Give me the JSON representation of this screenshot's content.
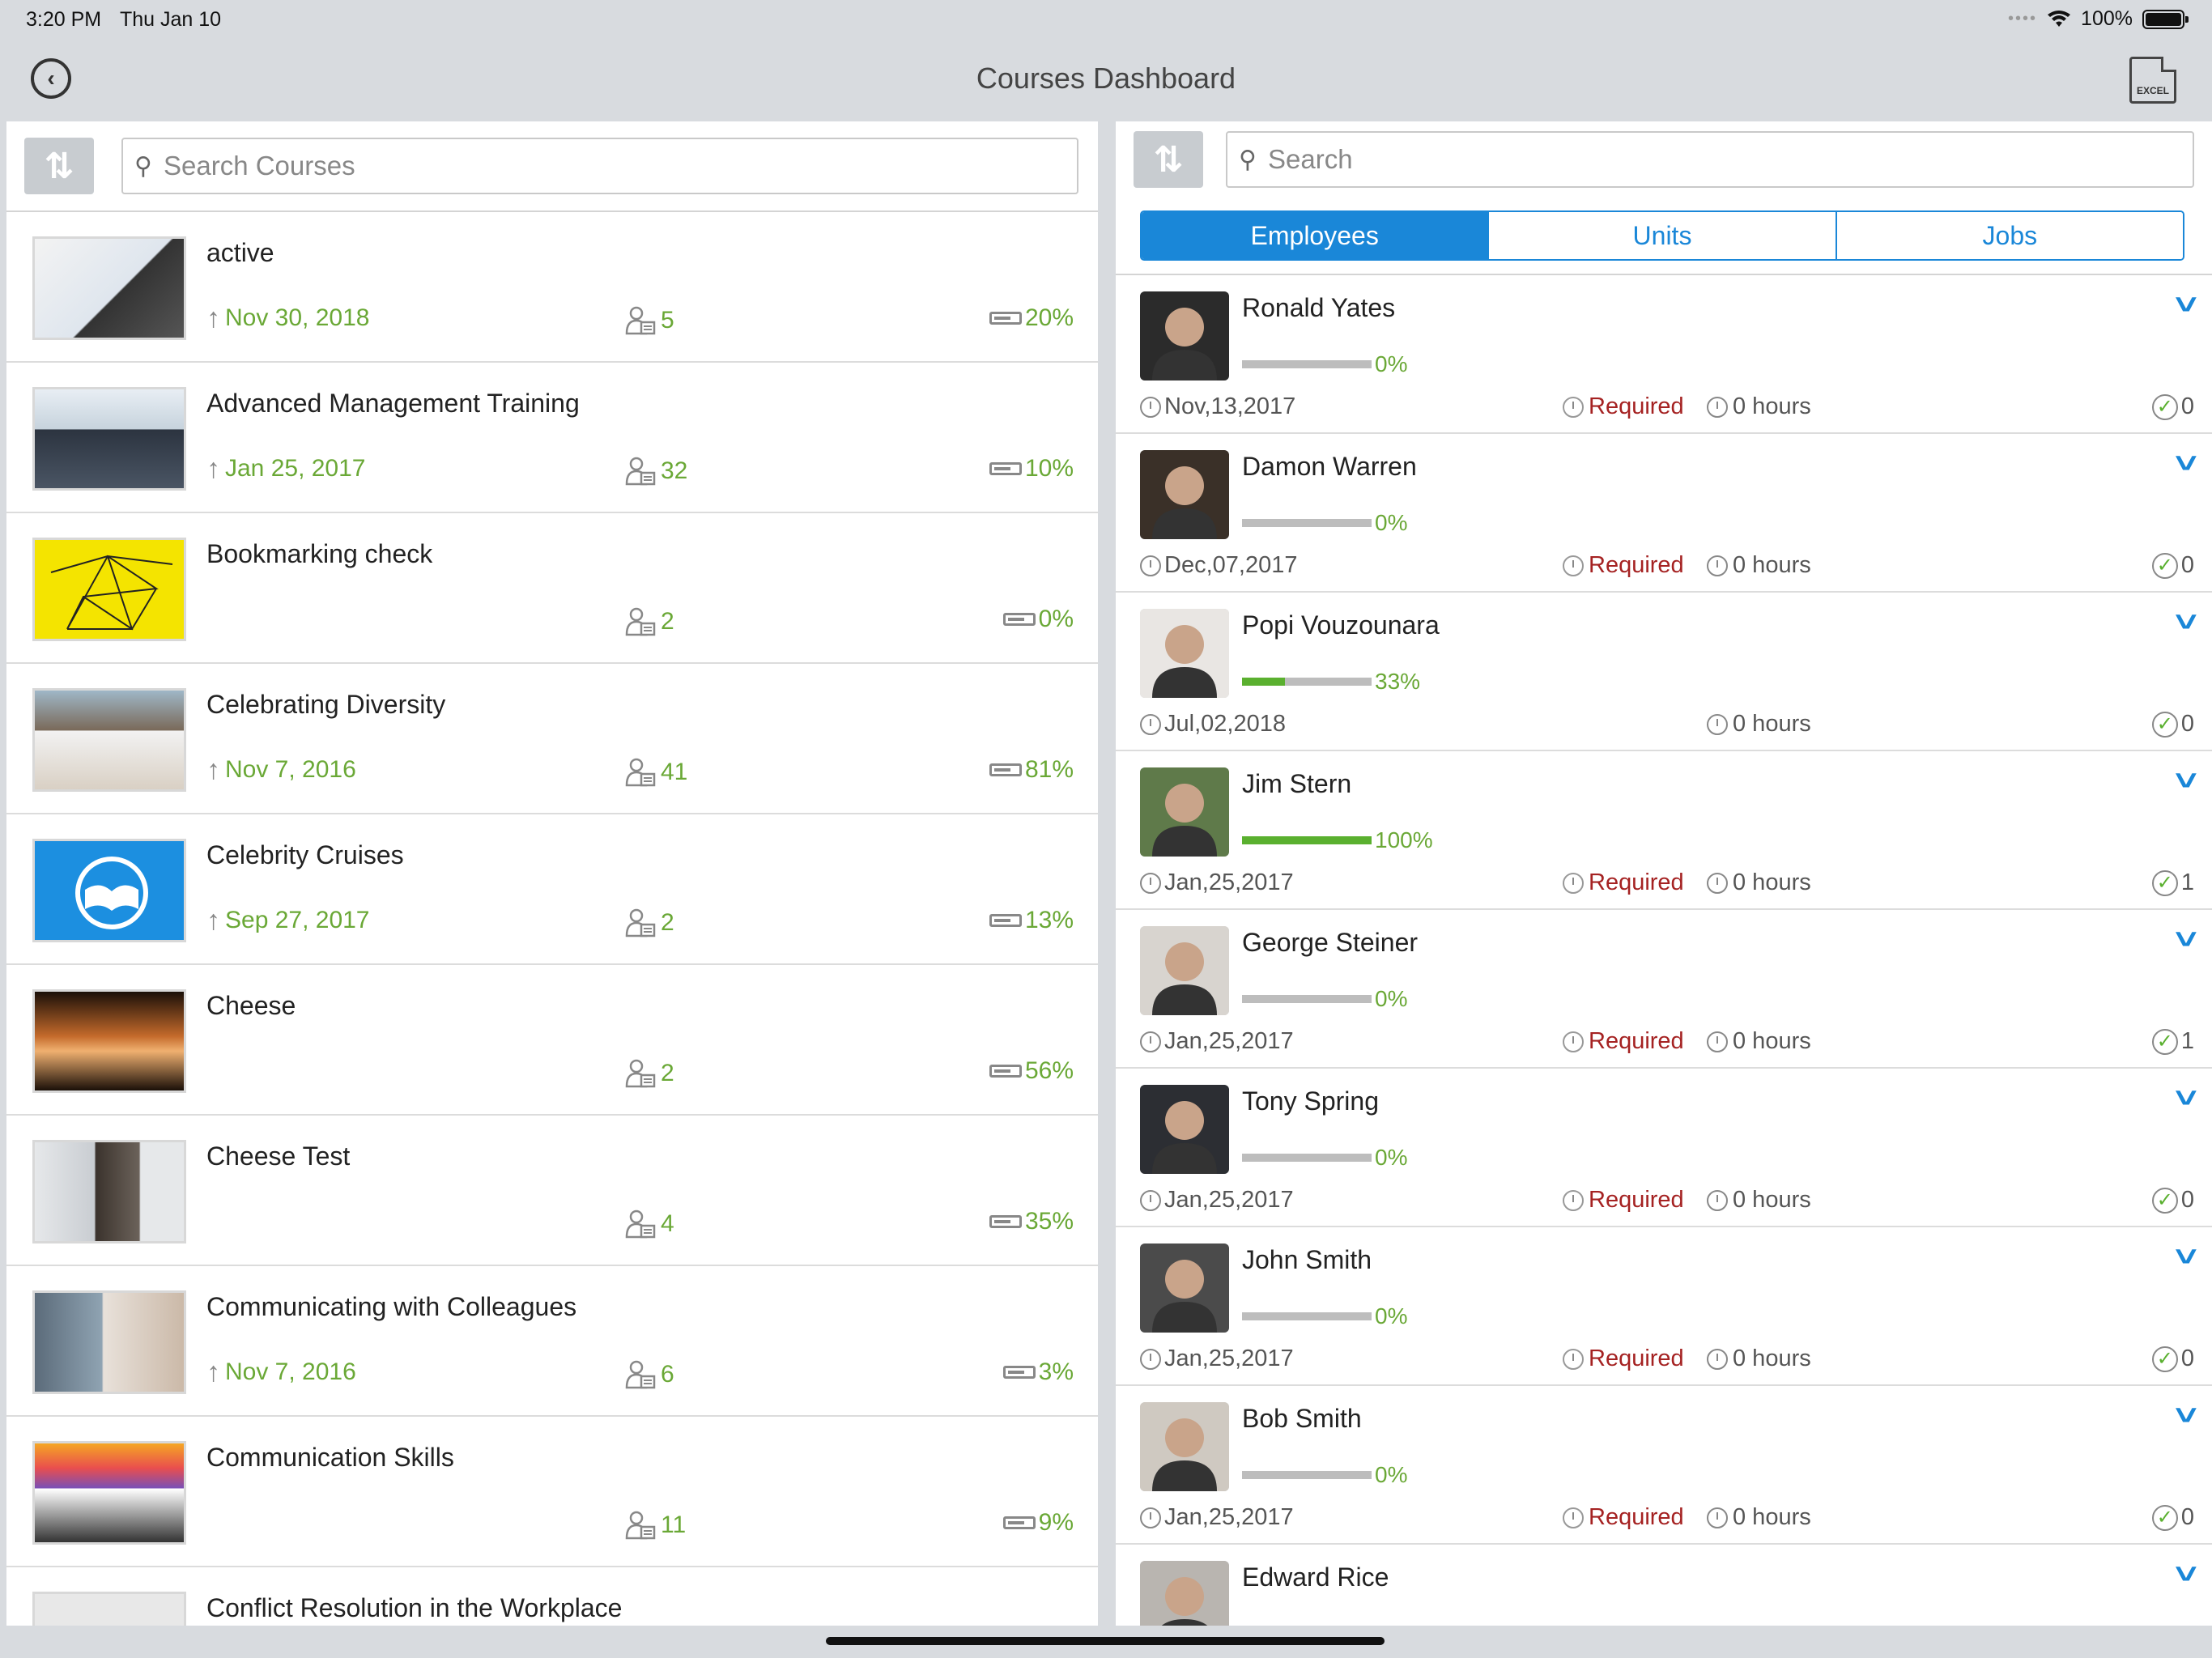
{
  "status_bar": {
    "time": "3:20 PM",
    "date": "Thu Jan 10",
    "battery": "100%"
  },
  "nav": {
    "title": "Courses Dashboard",
    "excel_label": "EXCEL"
  },
  "left_search": {
    "placeholder": "Search Courses"
  },
  "right_search": {
    "placeholder": "Search"
  },
  "courses": [
    {
      "title": "active",
      "date": "Nov 30, 2018",
      "enrolled": "5",
      "percent": "20%"
    },
    {
      "title": "Advanced Management Training",
      "date": "Jan 25, 2017",
      "enrolled": "32",
      "percent": "10%"
    },
    {
      "title": "Bookmarking check",
      "date": "",
      "enrolled": "2",
      "percent": "0%"
    },
    {
      "title": "Celebrating Diversity",
      "date": "Nov 7, 2016",
      "enrolled": "41",
      "percent": "81%"
    },
    {
      "title": "Celebrity Cruises",
      "date": "Sep 27, 2017",
      "enrolled": "2",
      "percent": "13%"
    },
    {
      "title": "Cheese",
      "date": "",
      "enrolled": "2",
      "percent": "56%"
    },
    {
      "title": "Cheese Test",
      "date": "",
      "enrolled": "4",
      "percent": "35%"
    },
    {
      "title": "Communicating with Colleagues",
      "date": "Nov 7, 2016",
      "enrolled": "6",
      "percent": "3%"
    },
    {
      "title": "Communication Skills",
      "date": "",
      "enrolled": "11",
      "percent": "9%"
    },
    {
      "title": "Conflict Resolution in the Workplace",
      "date": "",
      "enrolled": "",
      "percent": ""
    }
  ],
  "tabs": [
    "Employees",
    "Units",
    "Jobs"
  ],
  "active_tab": "Employees",
  "employees": [
    {
      "name": "Ronald Yates",
      "progress_label": "0%",
      "progress": 0,
      "date": "Nov,13,2017",
      "required": "Required",
      "hours": "0 hours",
      "completions": "0"
    },
    {
      "name": "Damon Warren",
      "progress_label": "0%",
      "progress": 0,
      "date": "Dec,07,2017",
      "required": "Required",
      "hours": "0 hours",
      "completions": "0"
    },
    {
      "name": "Popi Vouzounara",
      "progress_label": "33%",
      "progress": 0.33,
      "date": "Jul,02,2018",
      "required": "",
      "hours": "0 hours",
      "completions": "0"
    },
    {
      "name": "Jim Stern",
      "progress_label": "100%",
      "progress": 1.0,
      "date": "Jan,25,2017",
      "required": "Required",
      "hours": "0 hours",
      "completions": "1"
    },
    {
      "name": "George Steiner",
      "progress_label": "0%",
      "progress": 0,
      "date": "Jan,25,2017",
      "required": "Required",
      "hours": "0 hours",
      "completions": "1"
    },
    {
      "name": "Tony Spring",
      "progress_label": "0%",
      "progress": 0,
      "date": "Jan,25,2017",
      "required": "Required",
      "hours": "0 hours",
      "completions": "0"
    },
    {
      "name": "John Smith",
      "progress_label": "0%",
      "progress": 0,
      "date": "Jan,25,2017",
      "required": "Required",
      "hours": "0 hours",
      "completions": "0"
    },
    {
      "name": "Bob Smith",
      "progress_label": "0%",
      "progress": 0,
      "date": "Jan,25,2017",
      "required": "Required",
      "hours": "0 hours",
      "completions": "0"
    },
    {
      "name": "Edward Rice",
      "progress_label": "",
      "progress": 0,
      "date": "",
      "required": "",
      "hours": "",
      "completions": ""
    }
  ],
  "colors": {
    "accent": "#1a87d8",
    "green": "#6aa836",
    "required": "#a52222"
  },
  "icons": [
    "back-icon",
    "excel-export-icon",
    "sort-icon",
    "search-icon",
    "upload-arrow-icon",
    "enrolled-users-icon",
    "progress-bar-icon",
    "chevron-down-icon",
    "due-timer-icon",
    "required-icon",
    "hours-timer-icon",
    "completion-check-icon"
  ]
}
